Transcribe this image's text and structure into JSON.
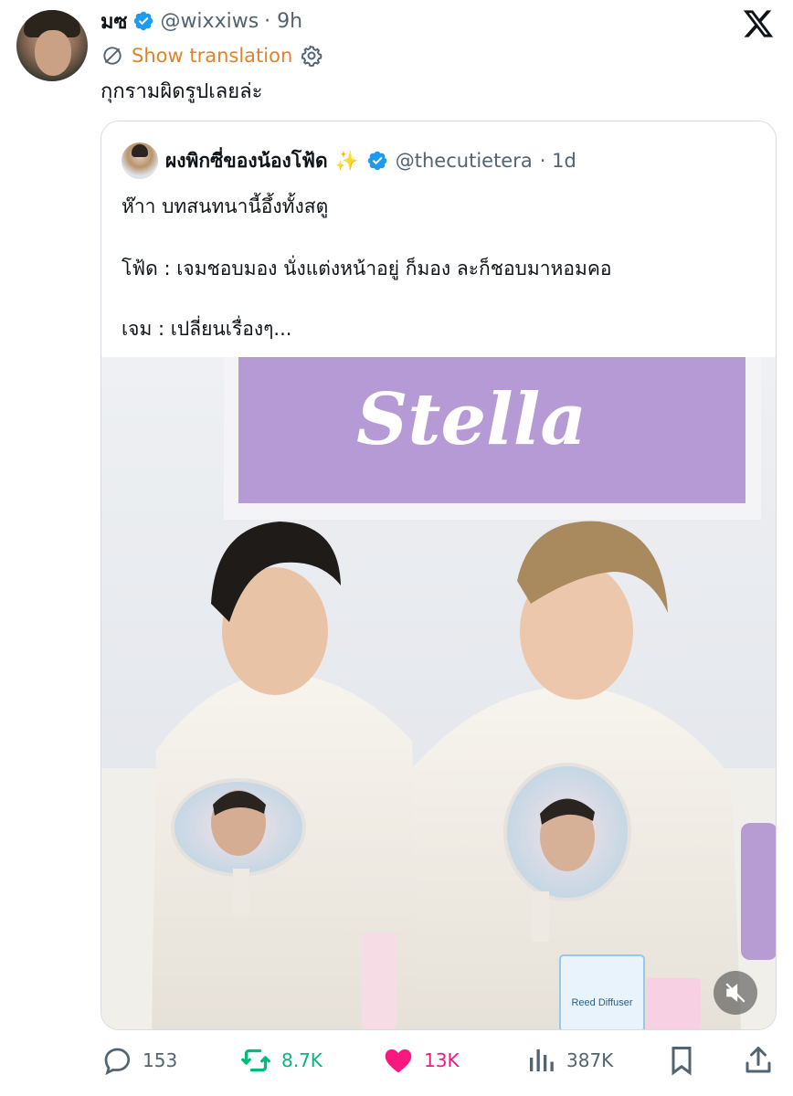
{
  "author": {
    "name": "มซ",
    "handle": "@wixxiws",
    "time": "· 9h",
    "verified": true
  },
  "translate": {
    "label": "Show translation"
  },
  "tweet": {
    "text": "กุกรามผิดรูปเลยล่ะ"
  },
  "quoted": {
    "name": "ผงพิกซี่ของน้องโฟ้ด",
    "emoji": "✨",
    "handle": "@thecutietera",
    "time": "· 1d",
    "lines": [
      "ห๊าา บทสนทนานี้อึ้งทั้งสตู",
      "โฟ้ด : เจมชอบมอง นั่งแต่งหน้าอยู่ ก็มอง ละก็ชอบมาหอมคอ",
      "เจม : เปลี่ยนเรื่องๆ..."
    ],
    "media": {
      "banner_text": "Stella",
      "product_label": "Reed Diffuser",
      "sound": "muted"
    }
  },
  "actions": {
    "replies": "153",
    "reposts": "8.7K",
    "likes": "13K",
    "views": "387K"
  },
  "colors": {
    "accent_orange": "#e0832a",
    "verified_blue": "#1d9bf0",
    "repost_green": "#00ba7c",
    "like_pink": "#f91880",
    "muted_gray": "#536471"
  },
  "icons": [
    "x-logo-icon",
    "verified-badge-icon",
    "no-translate-icon",
    "gear-icon",
    "reply-icon",
    "repost-icon",
    "like-icon",
    "views-icon",
    "bookmark-icon",
    "share-icon",
    "mute-icon"
  ]
}
